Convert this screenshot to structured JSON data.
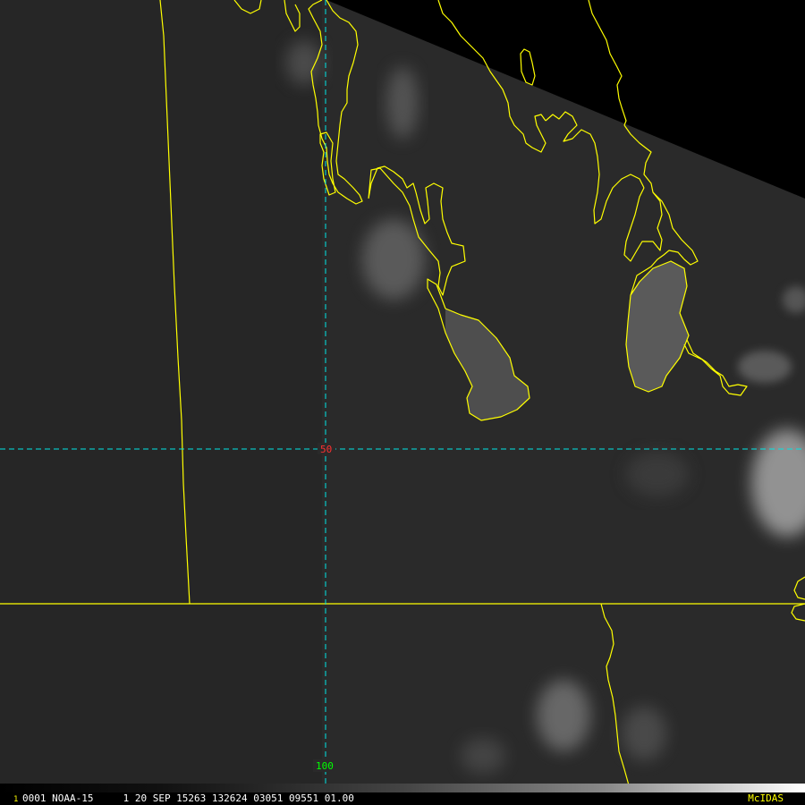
{
  "grid_labels": {
    "lat_50": "50",
    "lon_100": "100"
  },
  "status_bar": {
    "frame_number": "1",
    "text": "0001 NOAA-15     1 20 SEP 15263 132624 03051 09551 01.00",
    "brand": "McIDAS"
  },
  "colors": {
    "coastline": "#ffff00",
    "grid": "#00e5e5",
    "lat_label": "#ff3030",
    "lon_label": "#00ff00",
    "image_gray": "#2b2b2b",
    "no_data": "#000000"
  }
}
